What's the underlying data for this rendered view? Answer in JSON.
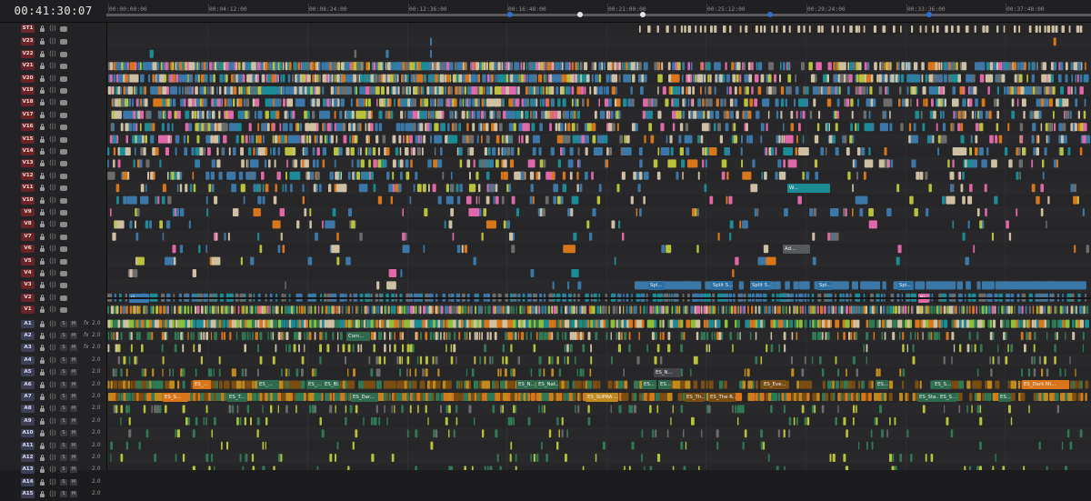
{
  "timecode": "00:41:30:07",
  "ruler": {
    "labels": [
      "00:00:00:00",
      "00:04:12:00",
      "00:08:24:00",
      "00:12:36:00",
      "00:16:48:00",
      "00:21:00:00",
      "00:25:12:00",
      "00:29:24:00",
      "00:33:36:00",
      "00:37:48:00"
    ],
    "marker_colors": [
      "#2b6fd6",
      "#e6e6e6",
      "#e6e6e6",
      "#2b6fd6",
      "#2b6fd6"
    ]
  },
  "subtitle_track": {
    "name": "ST1"
  },
  "video_tracks": [
    "V23",
    "V22",
    "V21",
    "V20",
    "V19",
    "V18",
    "V17",
    "V16",
    "V15",
    "V14",
    "V13",
    "V12",
    "V11",
    "V10",
    "V9",
    "V8",
    "V7",
    "V6",
    "V5",
    "V4",
    "V3",
    "V2",
    "V1"
  ],
  "audio_tracks": [
    {
      "name": "A1",
      "s": "S",
      "m": "M",
      "fx": "fx",
      "ch": "2.0"
    },
    {
      "name": "A2",
      "s": "S",
      "m": "M",
      "fx": "fx",
      "ch": "2.0"
    },
    {
      "name": "A3",
      "s": "S",
      "m": "M",
      "fx": "fx",
      "ch": "2.0"
    },
    {
      "name": "A4",
      "s": "S",
      "m": "M",
      "fx": "",
      "ch": "2.0"
    },
    {
      "name": "A5",
      "s": "S",
      "m": "M",
      "fx": "",
      "ch": "2.0"
    },
    {
      "name": "A6",
      "s": "S",
      "m": "M",
      "fx": "",
      "ch": "2.0"
    },
    {
      "name": "A7",
      "s": "S",
      "m": "M",
      "fx": "",
      "ch": "2.0"
    },
    {
      "name": "A8",
      "s": "S",
      "m": "M",
      "fx": "",
      "ch": "2.0"
    },
    {
      "name": "A9",
      "s": "S",
      "m": "M",
      "fx": "",
      "ch": "2.0"
    },
    {
      "name": "A10",
      "s": "S",
      "m": "M",
      "fx": "",
      "ch": "2.0"
    },
    {
      "name": "A11",
      "s": "S",
      "m": "M",
      "fx": "",
      "ch": "2.0"
    },
    {
      "name": "A12",
      "s": "S",
      "m": "M",
      "fx": "",
      "ch": "2.0"
    },
    {
      "name": "A13",
      "s": "S",
      "m": "M",
      "fx": "",
      "ch": "2.0"
    },
    {
      "name": "A14",
      "s": "S",
      "m": "M",
      "fx": "",
      "ch": "2.0"
    },
    {
      "name": "A15",
      "s": "S",
      "m": "M",
      "fx": "",
      "ch": "2.0"
    }
  ],
  "icons": {
    "lock": "lock-icon",
    "link": "link-icon",
    "eye": "eye-icon"
  },
  "clip_colors": {
    "blue": "#3b78a8",
    "teal": "#1b8c95",
    "cream": "#cfc0a3",
    "yellow": "#b9c23a",
    "pink": "#e067a8",
    "orange": "#d9761b",
    "gray": "#6c6c6c",
    "green": "#2f7a55",
    "darkorange": "#7a4d12",
    "gold": "#c08a1e",
    "lime": "#8cbf3a",
    "red": "#c2243a"
  },
  "clip_labels": [
    {
      "track": "V11",
      "text": "W...",
      "color": "#1b8c95"
    },
    {
      "track": "V6",
      "text": "Ad...",
      "color": "#55585c"
    },
    {
      "track": "V3",
      "text": "Spl...",
      "color": "#2c6fa3"
    },
    {
      "track": "V3",
      "text": "Split S...",
      "color": "#2c6fa3"
    },
    {
      "track": "V3",
      "text": "Split S...",
      "color": "#2c6fa3"
    },
    {
      "track": "V3",
      "text": "Spl...",
      "color": "#2c6fa3"
    },
    {
      "track": "V3",
      "text": "Spl...",
      "color": "#2c6fa3"
    },
    {
      "track": "V2",
      "text": "O...",
      "color": "#3a7ab0"
    },
    {
      "track": "V2",
      "text": "Bi...",
      "color": "#e067a8"
    },
    {
      "track": "A2",
      "text": "Com...",
      "color": "#2f6a4e"
    },
    {
      "track": "A5",
      "text": "ES_N...",
      "color": "#444448"
    },
    {
      "track": "A6",
      "text": "ES_...",
      "color": "#d9761b"
    },
    {
      "track": "A6",
      "text": "ES_...",
      "color": "#2f6a4e"
    },
    {
      "track": "A6",
      "text": "ES_...",
      "color": "#2f6a4e"
    },
    {
      "track": "A6",
      "text": "ES_Bl...",
      "color": "#2f6a4e"
    },
    {
      "track": "A6",
      "text": "ES_N...",
      "color": "#2f6a4e"
    },
    {
      "track": "A6",
      "text": "ES_Nat...",
      "color": "#2f6a4e"
    },
    {
      "track": "A6",
      "text": "ES...",
      "color": "#2f6a4e"
    },
    {
      "track": "A6",
      "text": "ES...",
      "color": "#2f6a4e"
    },
    {
      "track": "A6",
      "text": "ES_Eve...",
      "color": "#7a4d12"
    },
    {
      "track": "A6",
      "text": "ES...",
      "color": "#2f6a4e"
    },
    {
      "track": "A6",
      "text": "ES_S...",
      "color": "#2f6a4e"
    },
    {
      "track": "A6",
      "text": "ES_Dark Mi...",
      "color": "#d9761b"
    },
    {
      "track": "A7",
      "text": "ES_S...",
      "color": "#d9761b"
    },
    {
      "track": "A7",
      "text": "ES_T...",
      "color": "#2f6a4e"
    },
    {
      "track": "A7",
      "text": "ES_Dar...",
      "color": "#2f6a4e"
    },
    {
      "track": "A7",
      "text": "ES_SUPRA ...",
      "color": "#c08a1e"
    },
    {
      "track": "A7",
      "text": "ES_Th...",
      "color": "#7a4d12"
    },
    {
      "track": "A7",
      "text": "ES_The R...",
      "color": "#7a4d12"
    },
    {
      "track": "A7",
      "text": "ES_Sta...",
      "color": "#2f6a4e"
    },
    {
      "track": "A7",
      "text": "ES_S...",
      "color": "#2f6a4e"
    },
    {
      "track": "A7",
      "text": "ES...",
      "color": "#2f6a4e"
    }
  ]
}
